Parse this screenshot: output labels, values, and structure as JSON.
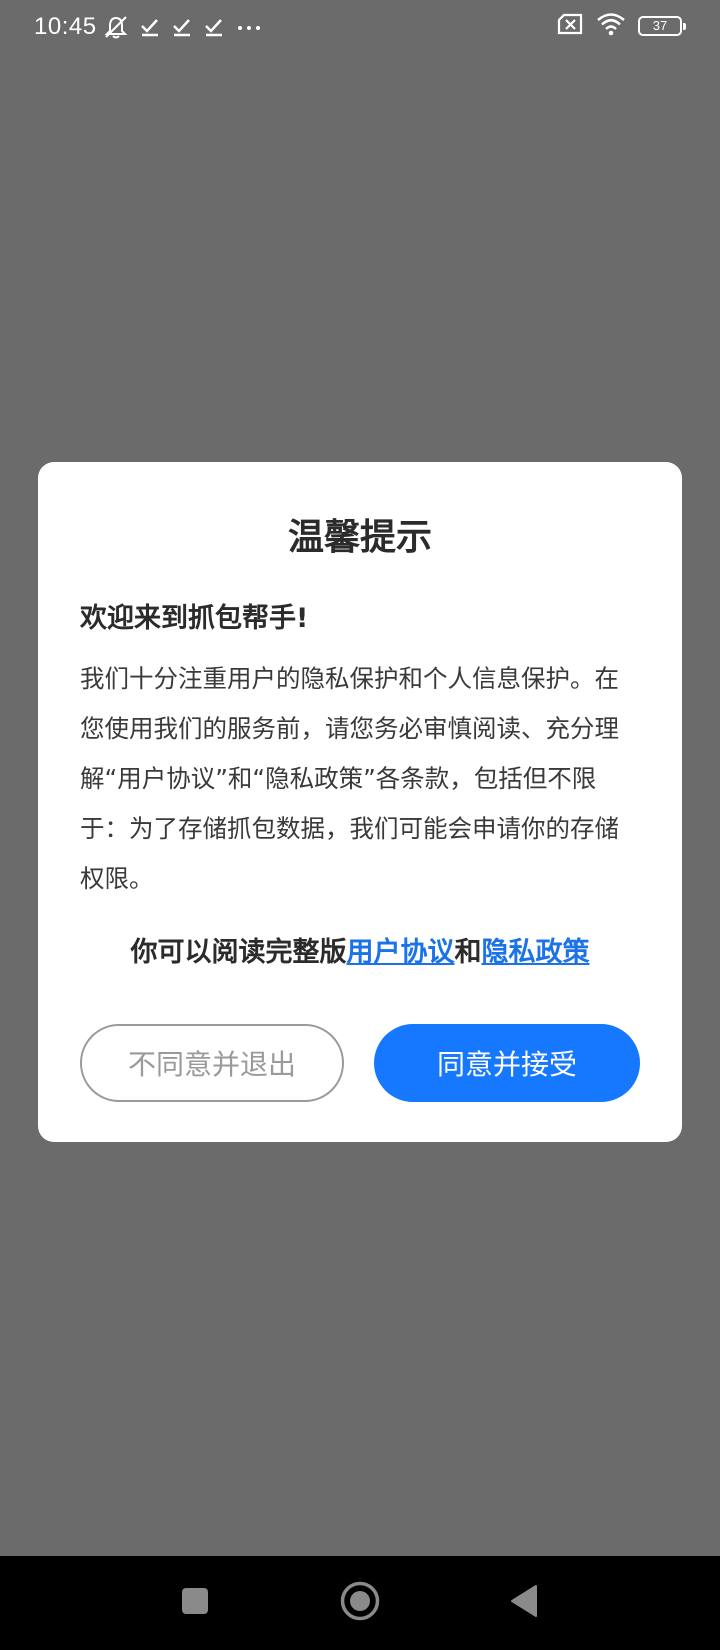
{
  "status_bar": {
    "time": "10:45",
    "battery": "37",
    "left_icons": [
      "bell-off-icon",
      "download-done-icon",
      "download-done-icon",
      "download-done-icon",
      "more-dots-icon"
    ],
    "right_icons": [
      "sim-off-icon",
      "wifi-icon",
      "battery-icon"
    ]
  },
  "dialog": {
    "title": "温馨提示",
    "welcome": "欢迎来到抓包帮手!",
    "body": "我们十分注重用户的隐私保护和个人信息保护。在您使用我们的服务前，请您务必审慎阅读、充分理解“用户协议”和“隐私政策”各条款，包括但不限于：为了存储抓包数据，我们可能会申请你的存储权限。",
    "links_prefix": "你可以阅读完整版",
    "user_agreement_link": "用户协议",
    "links_middle": "和",
    "privacy_policy_link": "隐私政策",
    "disagree_button": "不同意并退出",
    "agree_button": "同意并接受"
  },
  "colors": {
    "accent": "#1677ff",
    "link": "#1a73e8",
    "overlay": "#6b6b6b"
  },
  "nav_bar": {
    "items": [
      "recents-square-icon",
      "home-circle-icon",
      "back-triangle-icon"
    ]
  }
}
